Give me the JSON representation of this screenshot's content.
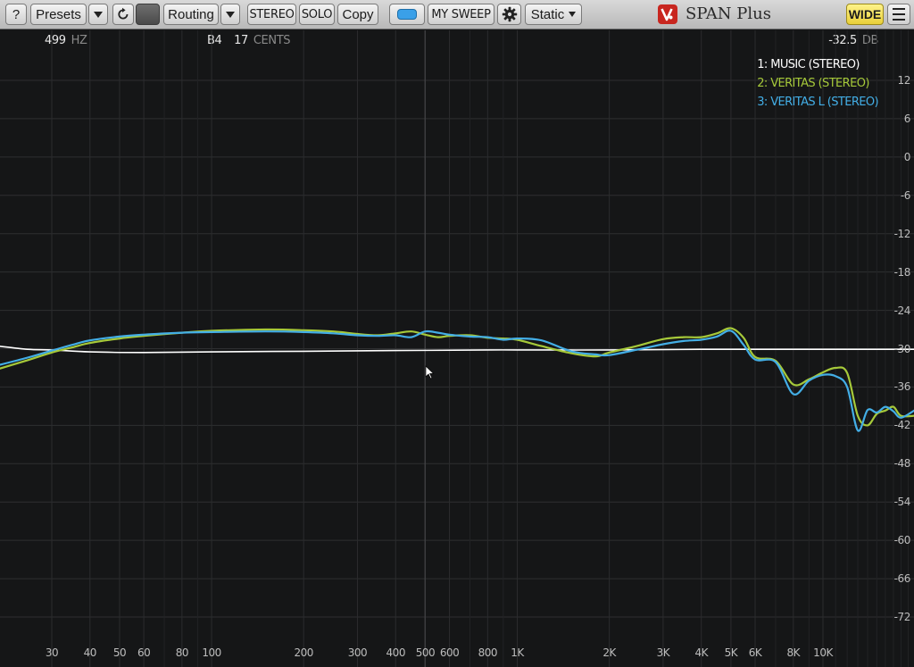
{
  "toolbar": {
    "help_label": "?",
    "presets_label": "Presets",
    "routing_label": "Routing",
    "stereo_label": "STEREO",
    "solo_label": "SOLO",
    "copy_label": "Copy",
    "mysweep_label": "MY SWEEP",
    "mode_label": "Static",
    "brand": "SPAN Plus",
    "wide_label": "WIDE",
    "accent": "#3aa0e8",
    "wide_color": "#f2e05a"
  },
  "readout": {
    "frequency": "499",
    "frequency_unit": "HZ",
    "note": "B4",
    "cents": "17",
    "cents_unit": "CENTS",
    "level": "-32.5",
    "level_unit": "DB"
  },
  "legend": [
    {
      "label": "1: MUSIC (STEREO)",
      "color": "#ffffff"
    },
    {
      "label": "2: VERITAS (STEREO)",
      "color": "#a6c93a"
    },
    {
      "label": "3: VERITAS L (STEREO)",
      "color": "#43aee6"
    }
  ],
  "chart_data": {
    "type": "line",
    "x_scale": "log",
    "xlim": [
      20,
      20000
    ],
    "ylim": [
      -78,
      18
    ],
    "yticks": [
      12,
      6,
      0,
      -6,
      -12,
      -18,
      -24,
      -30,
      -36,
      -42,
      -48,
      -54,
      -60,
      -66,
      -72
    ],
    "ytick_labels": [
      "12",
      "6",
      "0",
      "-6",
      "-12",
      "-18",
      "-24",
      "-30",
      "-36",
      "-42",
      "-48",
      "-54",
      "-60",
      "-66",
      "-72"
    ],
    "xticks": [
      30,
      40,
      50,
      60,
      80,
      100,
      200,
      300,
      400,
      500,
      600,
      800,
      1000,
      2000,
      3000,
      4000,
      5000,
      6000,
      8000,
      10000
    ],
    "xtick_labels": [
      "30",
      "40",
      "50",
      "60",
      "80",
      "100",
      "200",
      "300",
      "400",
      "500",
      "600",
      "800",
      "1K",
      "2K",
      "3K",
      "4K",
      "5K",
      "6K",
      "8K",
      "10K"
    ],
    "grid": true,
    "legend_position": "top-right",
    "series": [
      {
        "name": "1: MUSIC (STEREO)",
        "color": "#ffffff",
        "x": [
          20,
          25,
          30,
          40,
          60,
          100,
          200,
          400,
          800,
          1000,
          2000,
          4000,
          6000,
          10000,
          20000
        ],
        "y": [
          -29.6,
          -30.1,
          -30.2,
          -30.5,
          -30.6,
          -30.5,
          -30.4,
          -30.3,
          -30.2,
          -30.2,
          -30.2,
          -30.1,
          -30.1,
          -30.1,
          -30.1
        ]
      },
      {
        "name": "2: VERITAS (STEREO)",
        "color": "#a6c93a",
        "x": [
          20,
          25,
          30,
          35,
          40,
          50,
          60,
          80,
          100,
          150,
          200,
          250,
          300,
          350,
          400,
          450,
          500,
          550,
          600,
          700,
          800,
          900,
          1000,
          1200,
          1500,
          1800,
          2000,
          2500,
          3000,
          3500,
          4000,
          4500,
          5000,
          5500,
          6000,
          7000,
          8000,
          9000,
          10000,
          11000,
          12000,
          13000,
          14000,
          15000,
          16000,
          17000,
          18000,
          20000
        ],
        "y": [
          -33.2,
          -31.8,
          -30.6,
          -29.8,
          -29.1,
          -28.4,
          -28.0,
          -27.5,
          -27.2,
          -27.0,
          -27.1,
          -27.3,
          -27.7,
          -27.9,
          -27.6,
          -27.3,
          -27.8,
          -28.2,
          -28.0,
          -27.9,
          -28.3,
          -28.4,
          -28.6,
          -29.6,
          -30.7,
          -31.2,
          -30.6,
          -29.5,
          -28.5,
          -28.2,
          -28.2,
          -27.6,
          -26.8,
          -28.3,
          -31.3,
          -31.9,
          -35.6,
          -34.8,
          -33.7,
          -33.0,
          -33.8,
          -40.5,
          -42.0,
          -40.2,
          -39.7,
          -39.1,
          -40.5,
          -40.5
        ]
      },
      {
        "name": "3: VERITAS L (STEREO)",
        "color": "#43aee6",
        "x": [
          20,
          25,
          30,
          35,
          40,
          50,
          60,
          80,
          100,
          150,
          200,
          250,
          300,
          350,
          400,
          450,
          500,
          550,
          600,
          700,
          800,
          900,
          1000,
          1200,
          1500,
          1800,
          2000,
          2500,
          3000,
          3500,
          4000,
          4500,
          5000,
          5500,
          6000,
          7000,
          8000,
          9000,
          10000,
          11000,
          12000,
          13000,
          14000,
          15000,
          16000,
          17000,
          18000,
          20000
        ],
        "y": [
          -32.6,
          -31.4,
          -30.3,
          -29.4,
          -28.7,
          -28.1,
          -27.8,
          -27.5,
          -27.4,
          -27.3,
          -27.4,
          -27.6,
          -27.9,
          -28.0,
          -27.9,
          -28.2,
          -27.3,
          -27.5,
          -27.8,
          -28.1,
          -28.2,
          -28.6,
          -28.4,
          -28.7,
          -30.4,
          -30.9,
          -31.0,
          -30.1,
          -29.3,
          -28.8,
          -28.6,
          -28.1,
          -27.2,
          -29.4,
          -31.7,
          -32.1,
          -37.1,
          -35.0,
          -34.1,
          -34.3,
          -36.0,
          -42.8,
          -39.6,
          -40.0,
          -39.1,
          -39.8,
          -40.8,
          -39.6
        ]
      }
    ]
  }
}
